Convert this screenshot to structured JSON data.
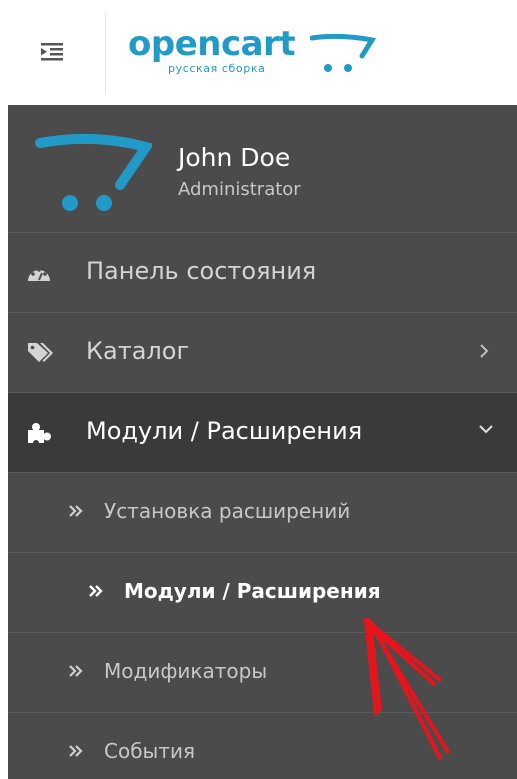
{
  "header": {
    "logo": {
      "word": "opencart",
      "subtitle": "русская сборка"
    }
  },
  "sidebar": {
    "profile": {
      "name": "John Doe",
      "role": "Administrator"
    },
    "menu": [
      {
        "label": "Панель состояния",
        "icon": "dashboard-icon"
      },
      {
        "label": "Каталог",
        "icon": "tags-icon",
        "arrow": "chevron-right-icon"
      },
      {
        "label": "Модули / Расширения",
        "icon": "puzzle-icon",
        "arrow": "chevron-down-icon",
        "active": true
      }
    ],
    "submenu": [
      {
        "label": "Установка расширений"
      },
      {
        "label": "Модули / Расширения",
        "current": true
      },
      {
        "label": "Модификаторы"
      },
      {
        "label": "События"
      }
    ]
  },
  "colors": {
    "brand": "#229ac8",
    "sidebar_bg": "#4b4b4b",
    "active_bg": "#3a3a3a",
    "annotation": "#e8141b"
  }
}
